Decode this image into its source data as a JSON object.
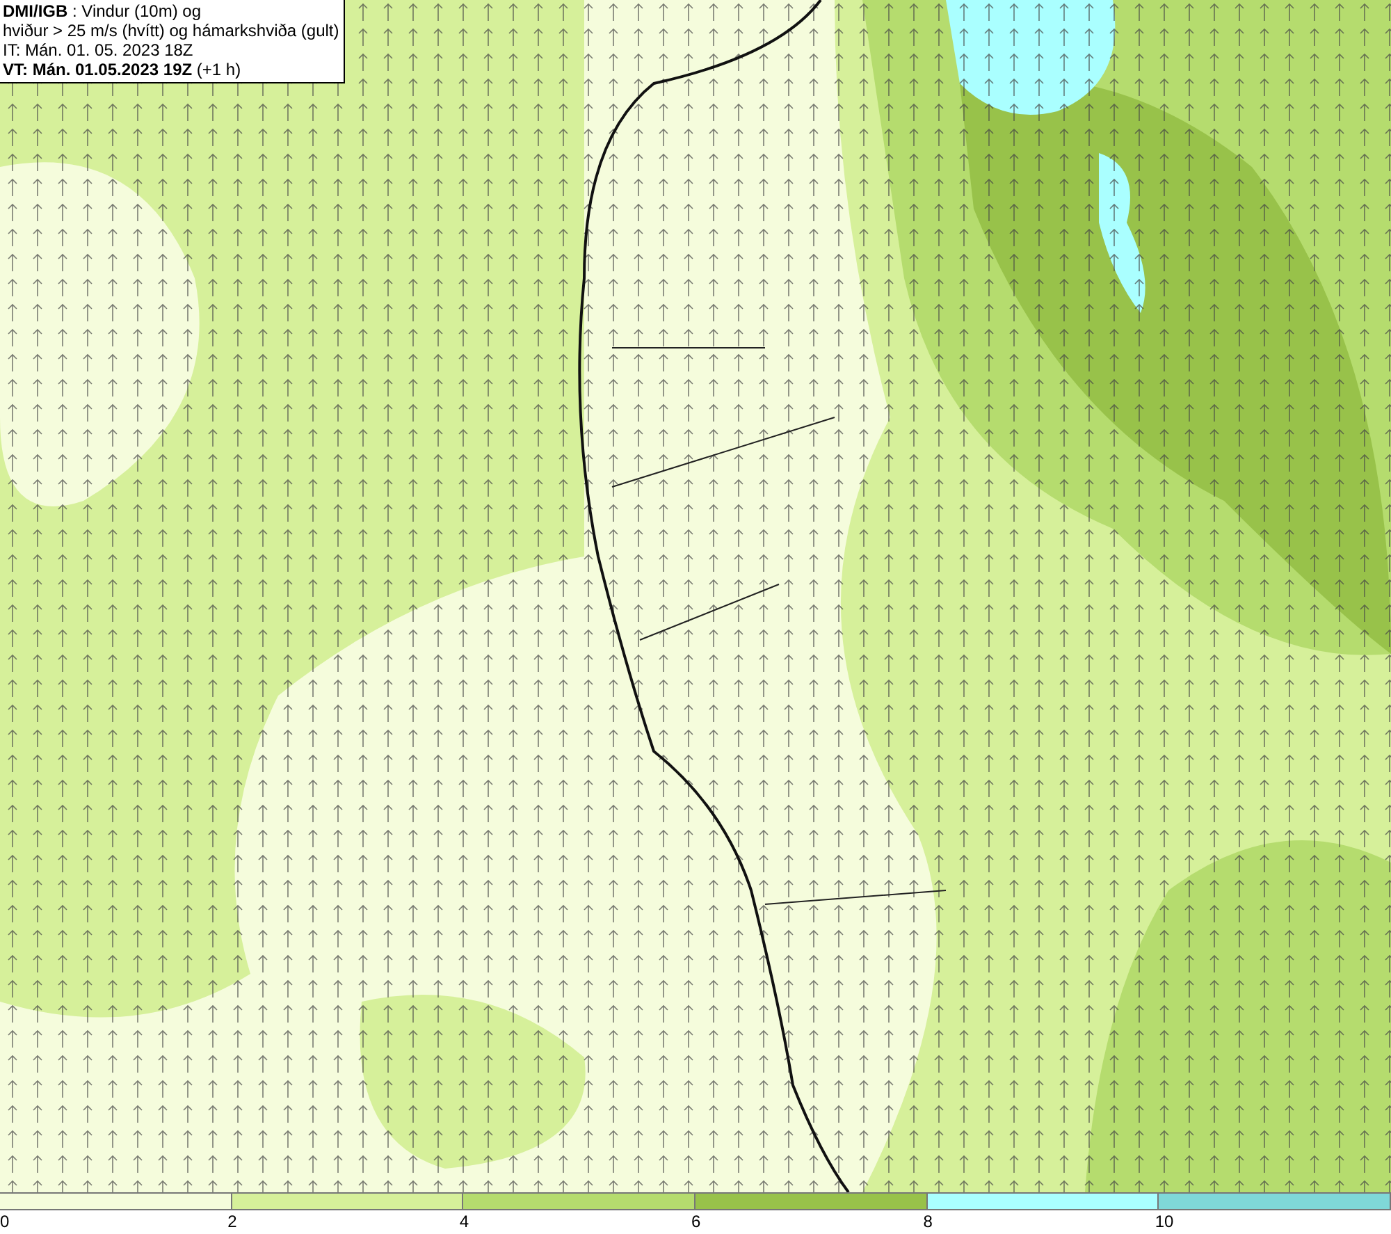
{
  "title_box": {
    "lines": [
      "**DMI/IGB** : Vindur (10m) og",
      "hviður > 25 m/s (hvítt) og hámarkshviða (gult)",
      "IT: Mán. 01. 05. 2023 18Z",
      "**VT: Mán. 01.05.2023 19Z** (+1 h)"
    ]
  },
  "legend": {
    "bins": [
      {
        "label": "0",
        "color": "#f5fcdc"
      },
      {
        "label": "2",
        "color": "#d6f09a"
      },
      {
        "label": "4",
        "color": "#b5dc6e"
      },
      {
        "label": "6",
        "color": "#98c24a"
      },
      {
        "label": "8",
        "color": "#aaffff"
      },
      {
        "label": "10",
        "color": "#7fd8d8"
      }
    ]
  }
}
